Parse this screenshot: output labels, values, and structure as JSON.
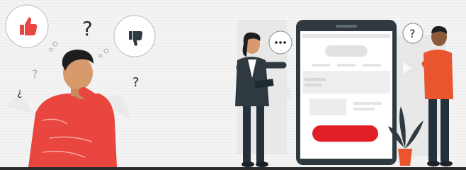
{
  "scene": {
    "left_figure": {
      "icons": [
        "thumbs-up-icon",
        "thumbs-down-icon",
        "question-mark-icon"
      ],
      "shirt_color": "#e8463e"
    },
    "center_figure": {
      "icons": [
        "speech-bubble-ellipsis-icon",
        "tablet-icon"
      ],
      "jacket_color": "#2f3a40"
    },
    "phone_mockup": {
      "button_color": "#e01f26",
      "frame_color": "#2e3a40"
    },
    "right_figure": {
      "icons": [
        "question-bubble-icon",
        "potted-plant-icon"
      ],
      "shirt_color": "#e8552e"
    }
  }
}
